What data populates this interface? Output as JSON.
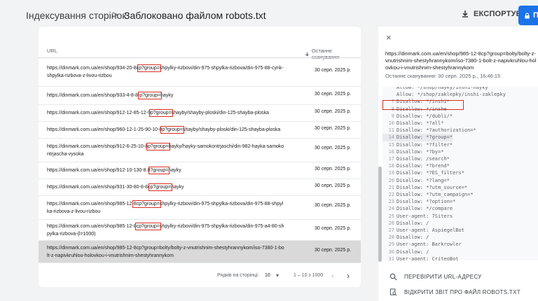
{
  "header": {
    "crumb_parent": "Індексування сторінок",
    "separator": ">",
    "crumb_current": "Заблоковано файлом robots.txt",
    "export_label": "ЕКСПОРТУВАТИ",
    "blue_button_label": "П"
  },
  "table": {
    "col_url": "URL",
    "col_date": "Останнє сканування",
    "rows": [
      {
        "url_pre": "https://dinmark.com.ua/en/shop/934-20-8c",
        "url_hl": "p?group=",
        "url_post": "shpylky-rizbovi/din-975-shpylka-rizbova/din-975-88-cynk-shpylka-rizbova-z-livou-rizbou",
        "date": "30 серп. 2025 р."
      },
      {
        "url_pre": "https://dinmark.com.ua/en/shop/933-4-8-8-",
        "url_hl": "p?group=",
        "url_post": "hayky",
        "date": "30 серп. 2025 р."
      },
      {
        "url_pre": "https://dinmark.com.ua/en/shop/912-12-85-12-9",
        "url_hl": "p?group=",
        "url_post": "shayby/shayby-ploski/din-125-shayba-ploska",
        "date": "30 серп. 2025 р."
      },
      {
        "url_pre": "https://dinmark.com.ua/en/shop/960-12-1-25-90-10-8",
        "url_hl": "p?group=",
        "url_post": "shayby/shayby-ploski/din-125-shayba-ploska",
        "date": "30 серп. 2025 р."
      },
      {
        "url_pre": "https://dinmark.com.ua/en/shop/912-6-25-10-8",
        "url_hl": "p?group=",
        "url_post": "hayky/hayky-samokontrjaschi/din-982-hayka-samokontrjascha-vysoka",
        "date": "30 серп. 2025 р."
      },
      {
        "url_pre": "https://dinmark.com.ua/en/shop/912-10-130-8.8",
        "url_hl": "?group=",
        "url_post": "hayky",
        "date": "30 серп. 2025 р."
      },
      {
        "url_pre": "https://dinmark.com.ua/en/shop/931-30-80-8-8c",
        "url_hl": "p?group=",
        "url_post": "hayky",
        "date": "30 серп. 2025 р."
      },
      {
        "url_pre": "https://dinmark.com.ua/en/shop/985-12-",
        "url_hl": "8cp?group=",
        "url_post": "shpylky-rizbovi/din-975-shpylka-rizbova/din-975-88-shpylka-rizbova-z-livou-rizbou",
        "date": "30 серп. 2025 р."
      },
      {
        "url_pre": "https://dinmark.com.ua/en/shop/985-12-8",
        "url_hl": "cp?group=",
        "url_post": "shpylky-rizbovi/din-975-shpylka-rizbova/din-975-a4-80-shpylka-rizbova-(l=1000)",
        "date": "30 серп. 2025 р."
      },
      {
        "url_pre": "https://dinmark.com.ua/en/shop/985-12-8cp?group=bolty/bolty-z-vnutrishnim-shestyhrannykom/iso-7380-1-bolt-z-napivkruhlou-holovkou-i-vnutrishnim-shestyhrannykom",
        "url_hl": "",
        "url_post": "",
        "date": "30 серп. 2025 р."
      }
    ],
    "pager": {
      "rows_per_page_label": "Рядків на сторінці:",
      "rows_per_page_value": "10",
      "caret": "▾",
      "range": "1 – 10 з 1000",
      "prev": "‹",
      "next": "›"
    }
  },
  "panel": {
    "close": "×",
    "url": "https://dinmark.com.ua/en/shop/985-12-8cp?group=bolty/bolty-z-vnutrishnim-shestyhrannykom/iso-7380-1-bolt-z-napivkruhlou-holovkou-i-vnutrishnim-shestyhrannykom",
    "last_scan": "Останнє сканування: 30 серп. 2025 р., 16:46:15",
    "code_lines": [
      {
        "n": "",
        "t": "Allow: */shop/hayky/inshi-hayky"
      },
      {
        "n": "",
        "t": "Allow: */shop/zaklepky/inshi-zaklepky"
      },
      {
        "n": "7",
        "t": "Disallow: */inshi*"
      },
      {
        "n": "8",
        "t": "Disallow: */inshe"
      },
      {
        "n": "9",
        "t": "Disallow: */dubli/*"
      },
      {
        "n": "10",
        "t": "Disallow: *?all*"
      },
      {
        "n": "11",
        "t": "Disallow: *?authorization=*"
      },
      {
        "n": "14",
        "t": "Disallow: *?group=*"
      },
      {
        "n": "15",
        "t": "Disallow: *?filter*"
      },
      {
        "n": "16",
        "t": "Disallow: *?by=*"
      },
      {
        "n": "17",
        "t": "Disallow: /search*"
      },
      {
        "n": "18",
        "t": "Disallow: *?brend*"
      },
      {
        "n": "19",
        "t": "Disallow: *?ES_filters*"
      },
      {
        "n": "20",
        "t": "Disallow: *?lang=*"
      },
      {
        "n": "21",
        "t": "Disallow: *?utm_source=*"
      },
      {
        "n": "22",
        "t": "Disallow: *?utm_campaign=*"
      },
      {
        "n": "23",
        "t": "Disallow: *?option=*"
      },
      {
        "n": "24",
        "t": "Disallow: */compare"
      },
      {
        "n": "25",
        "t": "User-agent: 7Siters"
      },
      {
        "n": "26",
        "t": "Disallow: /"
      },
      {
        "n": "27",
        "t": "User-agent: AspiegelBot"
      },
      {
        "n": "28",
        "t": "Disallow: /"
      },
      {
        "n": "29",
        "t": "User-agent: Barkrowler"
      },
      {
        "n": "30",
        "t": "Disallow: /"
      },
      {
        "n": "31",
        "t": "User-agent: CriteoBot"
      }
    ],
    "highlight_index": 7,
    "actions": {
      "check_url": "ПЕРЕВІРИТИ URL-АДРЕСУ",
      "open_report": "ВІДКРИТИ ЗВІТ ПРО ФАЙЛ ROBOTS.TXT"
    }
  }
}
